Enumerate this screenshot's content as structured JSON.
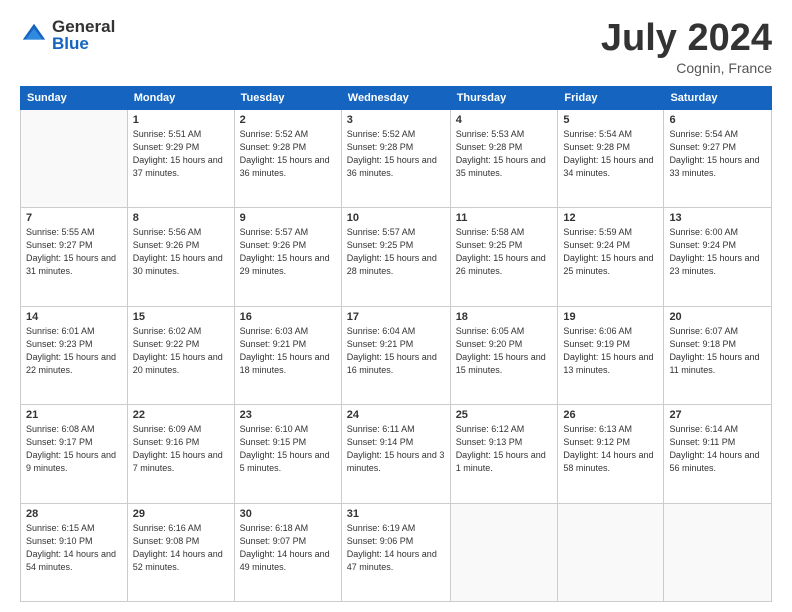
{
  "logo": {
    "general": "General",
    "blue": "Blue"
  },
  "title": "July 2024",
  "location": "Cognin, France",
  "days_of_week": [
    "Sunday",
    "Monday",
    "Tuesday",
    "Wednesday",
    "Thursday",
    "Friday",
    "Saturday"
  ],
  "weeks": [
    [
      {
        "day": "",
        "sunrise": "",
        "sunset": "",
        "daylight": ""
      },
      {
        "day": "1",
        "sunrise": "Sunrise: 5:51 AM",
        "sunset": "Sunset: 9:29 PM",
        "daylight": "Daylight: 15 hours and 37 minutes."
      },
      {
        "day": "2",
        "sunrise": "Sunrise: 5:52 AM",
        "sunset": "Sunset: 9:28 PM",
        "daylight": "Daylight: 15 hours and 36 minutes."
      },
      {
        "day": "3",
        "sunrise": "Sunrise: 5:52 AM",
        "sunset": "Sunset: 9:28 PM",
        "daylight": "Daylight: 15 hours and 36 minutes."
      },
      {
        "day": "4",
        "sunrise": "Sunrise: 5:53 AM",
        "sunset": "Sunset: 9:28 PM",
        "daylight": "Daylight: 15 hours and 35 minutes."
      },
      {
        "day": "5",
        "sunrise": "Sunrise: 5:54 AM",
        "sunset": "Sunset: 9:28 PM",
        "daylight": "Daylight: 15 hours and 34 minutes."
      },
      {
        "day": "6",
        "sunrise": "Sunrise: 5:54 AM",
        "sunset": "Sunset: 9:27 PM",
        "daylight": "Daylight: 15 hours and 33 minutes."
      }
    ],
    [
      {
        "day": "7",
        "sunrise": "Sunrise: 5:55 AM",
        "sunset": "Sunset: 9:27 PM",
        "daylight": "Daylight: 15 hours and 31 minutes."
      },
      {
        "day": "8",
        "sunrise": "Sunrise: 5:56 AM",
        "sunset": "Sunset: 9:26 PM",
        "daylight": "Daylight: 15 hours and 30 minutes."
      },
      {
        "day": "9",
        "sunrise": "Sunrise: 5:57 AM",
        "sunset": "Sunset: 9:26 PM",
        "daylight": "Daylight: 15 hours and 29 minutes."
      },
      {
        "day": "10",
        "sunrise": "Sunrise: 5:57 AM",
        "sunset": "Sunset: 9:25 PM",
        "daylight": "Daylight: 15 hours and 28 minutes."
      },
      {
        "day": "11",
        "sunrise": "Sunrise: 5:58 AM",
        "sunset": "Sunset: 9:25 PM",
        "daylight": "Daylight: 15 hours and 26 minutes."
      },
      {
        "day": "12",
        "sunrise": "Sunrise: 5:59 AM",
        "sunset": "Sunset: 9:24 PM",
        "daylight": "Daylight: 15 hours and 25 minutes."
      },
      {
        "day": "13",
        "sunrise": "Sunrise: 6:00 AM",
        "sunset": "Sunset: 9:24 PM",
        "daylight": "Daylight: 15 hours and 23 minutes."
      }
    ],
    [
      {
        "day": "14",
        "sunrise": "Sunrise: 6:01 AM",
        "sunset": "Sunset: 9:23 PM",
        "daylight": "Daylight: 15 hours and 22 minutes."
      },
      {
        "day": "15",
        "sunrise": "Sunrise: 6:02 AM",
        "sunset": "Sunset: 9:22 PM",
        "daylight": "Daylight: 15 hours and 20 minutes."
      },
      {
        "day": "16",
        "sunrise": "Sunrise: 6:03 AM",
        "sunset": "Sunset: 9:21 PM",
        "daylight": "Daylight: 15 hours and 18 minutes."
      },
      {
        "day": "17",
        "sunrise": "Sunrise: 6:04 AM",
        "sunset": "Sunset: 9:21 PM",
        "daylight": "Daylight: 15 hours and 16 minutes."
      },
      {
        "day": "18",
        "sunrise": "Sunrise: 6:05 AM",
        "sunset": "Sunset: 9:20 PM",
        "daylight": "Daylight: 15 hours and 15 minutes."
      },
      {
        "day": "19",
        "sunrise": "Sunrise: 6:06 AM",
        "sunset": "Sunset: 9:19 PM",
        "daylight": "Daylight: 15 hours and 13 minutes."
      },
      {
        "day": "20",
        "sunrise": "Sunrise: 6:07 AM",
        "sunset": "Sunset: 9:18 PM",
        "daylight": "Daylight: 15 hours and 11 minutes."
      }
    ],
    [
      {
        "day": "21",
        "sunrise": "Sunrise: 6:08 AM",
        "sunset": "Sunset: 9:17 PM",
        "daylight": "Daylight: 15 hours and 9 minutes."
      },
      {
        "day": "22",
        "sunrise": "Sunrise: 6:09 AM",
        "sunset": "Sunset: 9:16 PM",
        "daylight": "Daylight: 15 hours and 7 minutes."
      },
      {
        "day": "23",
        "sunrise": "Sunrise: 6:10 AM",
        "sunset": "Sunset: 9:15 PM",
        "daylight": "Daylight: 15 hours and 5 minutes."
      },
      {
        "day": "24",
        "sunrise": "Sunrise: 6:11 AM",
        "sunset": "Sunset: 9:14 PM",
        "daylight": "Daylight: 15 hours and 3 minutes."
      },
      {
        "day": "25",
        "sunrise": "Sunrise: 6:12 AM",
        "sunset": "Sunset: 9:13 PM",
        "daylight": "Daylight: 15 hours and 1 minute."
      },
      {
        "day": "26",
        "sunrise": "Sunrise: 6:13 AM",
        "sunset": "Sunset: 9:12 PM",
        "daylight": "Daylight: 14 hours and 58 minutes."
      },
      {
        "day": "27",
        "sunrise": "Sunrise: 6:14 AM",
        "sunset": "Sunset: 9:11 PM",
        "daylight": "Daylight: 14 hours and 56 minutes."
      }
    ],
    [
      {
        "day": "28",
        "sunrise": "Sunrise: 6:15 AM",
        "sunset": "Sunset: 9:10 PM",
        "daylight": "Daylight: 14 hours and 54 minutes."
      },
      {
        "day": "29",
        "sunrise": "Sunrise: 6:16 AM",
        "sunset": "Sunset: 9:08 PM",
        "daylight": "Daylight: 14 hours and 52 minutes."
      },
      {
        "day": "30",
        "sunrise": "Sunrise: 6:18 AM",
        "sunset": "Sunset: 9:07 PM",
        "daylight": "Daylight: 14 hours and 49 minutes."
      },
      {
        "day": "31",
        "sunrise": "Sunrise: 6:19 AM",
        "sunset": "Sunset: 9:06 PM",
        "daylight": "Daylight: 14 hours and 47 minutes."
      },
      {
        "day": "",
        "sunrise": "",
        "sunset": "",
        "daylight": ""
      },
      {
        "day": "",
        "sunrise": "",
        "sunset": "",
        "daylight": ""
      },
      {
        "day": "",
        "sunrise": "",
        "sunset": "",
        "daylight": ""
      }
    ]
  ]
}
